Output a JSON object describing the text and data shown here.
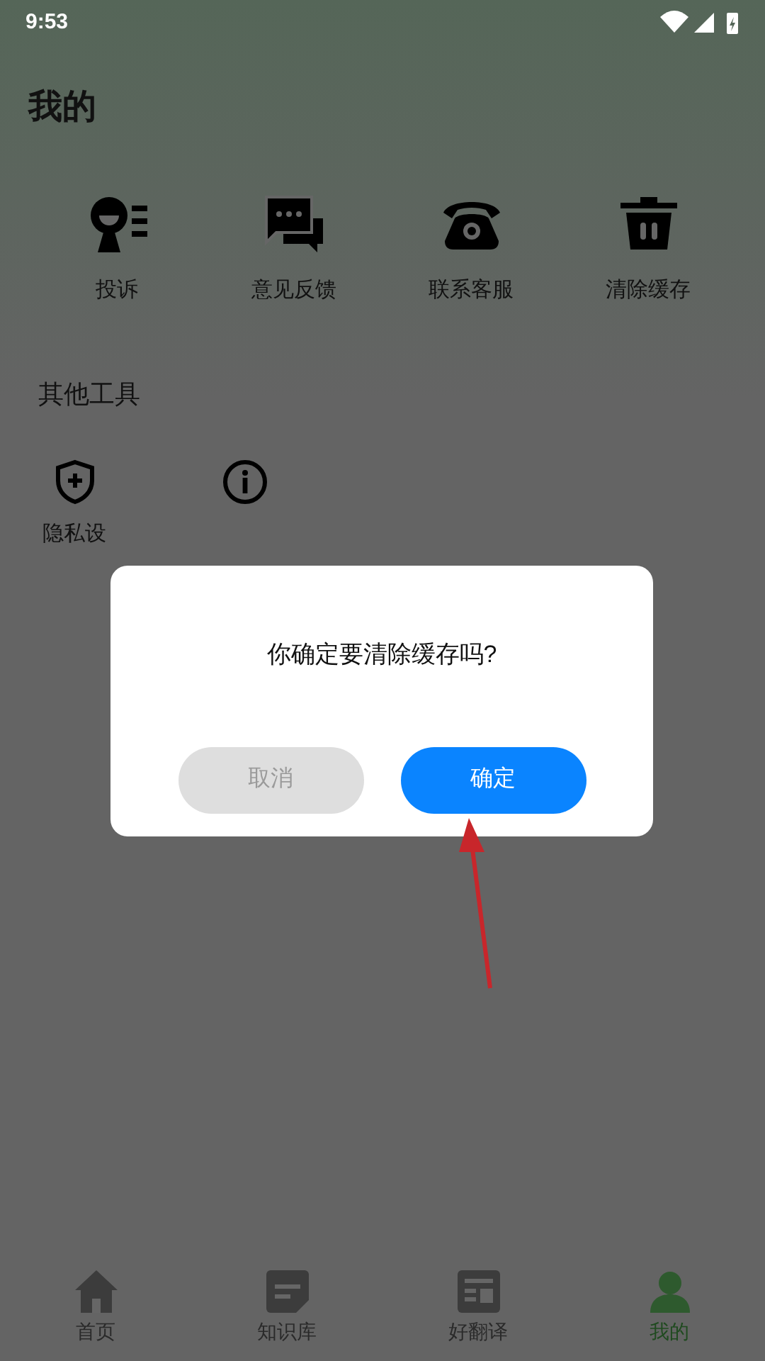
{
  "status_bar": {
    "time": "9:53"
  },
  "title": "我的",
  "actions": [
    {
      "kind": "complaint",
      "label": "投诉"
    },
    {
      "kind": "feedback",
      "label": "意见反馈"
    },
    {
      "kind": "phone",
      "label": "联系客服"
    },
    {
      "kind": "trash",
      "label": "清除缓存"
    }
  ],
  "tools_section": {
    "title": "其他工具",
    "items": [
      {
        "kind": "shield",
        "label": "隐私设"
      },
      {
        "kind": "info"
      }
    ]
  },
  "dialog": {
    "message": "你确定要清除缓存吗?",
    "buttons": [
      {
        "label": "取消",
        "kind": "cancel"
      },
      {
        "label": "确定",
        "kind": "confirm"
      }
    ]
  },
  "bottom_nav": [
    {
      "kind": "home",
      "label": "首页",
      "selected": false
    },
    {
      "kind": "doc",
      "label": "知识库",
      "selected": false
    },
    {
      "kind": "translate",
      "label": "好翻译",
      "selected": false
    },
    {
      "kind": "me",
      "label": "我的",
      "selected": true
    }
  ]
}
